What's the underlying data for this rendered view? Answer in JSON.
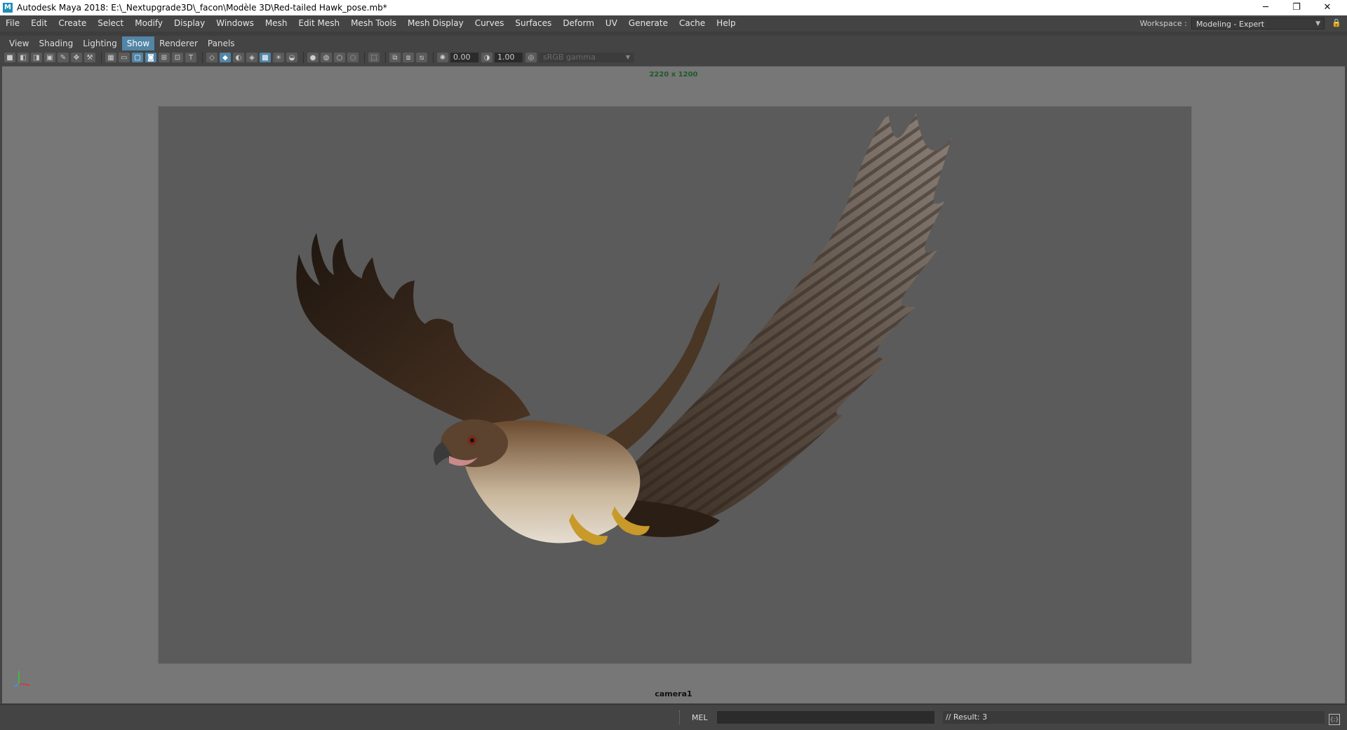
{
  "window": {
    "app_icon_letter": "M",
    "title": "Autodesk Maya 2018: E:\\_Nextupgrade3D\\_facon\\Modèle 3D\\Red-tailed Hawk_pose.mb*",
    "controls": {
      "minimize": "─",
      "restore": "❐",
      "close": "✕"
    }
  },
  "menubar": {
    "items": [
      "File",
      "Edit",
      "Create",
      "Select",
      "Modify",
      "Display",
      "Windows",
      "Mesh",
      "Edit Mesh",
      "Mesh Tools",
      "Mesh Display",
      "Curves",
      "Surfaces",
      "Deform",
      "UV",
      "Generate",
      "Cache",
      "Help"
    ]
  },
  "workspace": {
    "label": "Workspace :",
    "value": "Modeling - Expert"
  },
  "panel_menu": {
    "items": [
      "View",
      "Shading",
      "Lighting",
      "Show",
      "Renderer",
      "Panels"
    ],
    "active": "Show"
  },
  "panel_toolbar": {
    "exposure": "0.00",
    "gamma": "1.00",
    "color_space": "sRGB gamma"
  },
  "viewport": {
    "resolution": "2220 x 1200",
    "camera": "camera1",
    "subject": "red-tailed hawk 3D model"
  },
  "command_line": {
    "language": "MEL",
    "input": "",
    "result": "// Result: 3"
  },
  "colors": {
    "accent": "#5285a6",
    "viewport_bg": "#777777",
    "gate_bg": "#5b5b5b",
    "resolution_text": "#1d5a2a"
  }
}
